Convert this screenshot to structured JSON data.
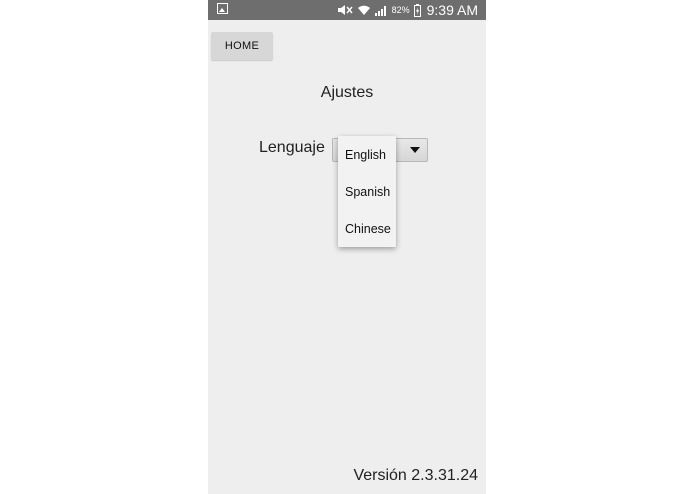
{
  "status_bar": {
    "battery_percent": "82%",
    "time": "9:39 AM",
    "icons": [
      "gallery-icon",
      "mute-icon",
      "wifi-icon",
      "signal-icon",
      "battery-icon"
    ]
  },
  "toolbar": {
    "home_label": "HOME"
  },
  "settings": {
    "title": "Ajustes",
    "language_label": "Lenguaje",
    "language_options": [
      "English",
      "Spanish",
      "Chinese"
    ]
  },
  "footer": {
    "version": "Versión 2.3.31.24"
  },
  "colors": {
    "status_bar": "#6e6e6e",
    "background": "#eeeeee",
    "button": "#d7d7d7"
  }
}
